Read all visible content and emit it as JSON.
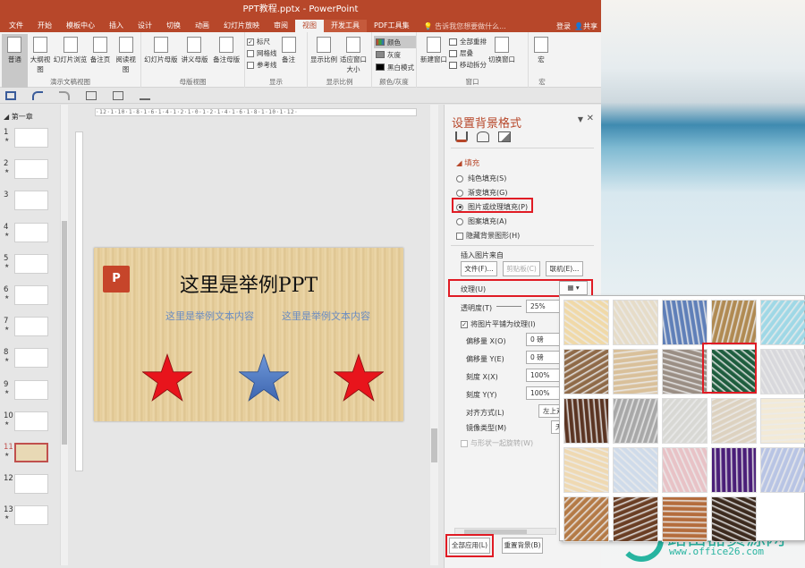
{
  "window": {
    "title": "PPT教程.pptx - PowerPoint"
  },
  "tabs": [
    "文件",
    "开始",
    "模板中心",
    "插入",
    "设计",
    "切换",
    "动画",
    "幻灯片放映",
    "审阅",
    "视图",
    "开发工具",
    "PDF工具集"
  ],
  "active_tab": "视图",
  "tell_me": "告诉我您想要做什么...",
  "account": {
    "login": "登录",
    "share": "共享"
  },
  "ribbon": {
    "presentation_views": {
      "label": "演示文稿视图",
      "items": [
        "普通",
        "大纲视图",
        "幻灯片浏览",
        "备注页",
        "阅读视图"
      ]
    },
    "master_views": {
      "label": "母版视图",
      "items": [
        "幻灯片母版",
        "讲义母版",
        "备注母版"
      ]
    },
    "show": {
      "label": "显示",
      "checks": [
        {
          "text": "标尺",
          "checked": true
        },
        {
          "text": "网格线",
          "checked": false
        },
        {
          "text": "参考线",
          "checked": false
        }
      ]
    },
    "notes": "备注",
    "zoom": {
      "label": "显示比例",
      "items": [
        "显示比例",
        "适应窗口大小"
      ]
    },
    "color": {
      "label": "颜色/灰度",
      "items": [
        "颜色",
        "灰度",
        "黑白模式"
      ]
    },
    "window": {
      "label": "窗口",
      "new_window": "新建窗口",
      "arrange_all": "全部重排",
      "cascade": "层叠",
      "move_split": "移动拆分",
      "switch_windows": "切换窗口"
    },
    "macro": {
      "label": "宏",
      "item": "宏"
    }
  },
  "sidebar": {
    "section": "第一章",
    "slides": [
      {
        "num": "1",
        "star": true
      },
      {
        "num": "2",
        "star": true
      },
      {
        "num": "3",
        "star": false
      },
      {
        "num": "4",
        "star": true
      },
      {
        "num": "5",
        "star": true
      },
      {
        "num": "6",
        "star": true
      },
      {
        "num": "7",
        "star": true
      },
      {
        "num": "8",
        "star": true
      },
      {
        "num": "9",
        "star": true
      },
      {
        "num": "10",
        "star": true
      },
      {
        "num": "11",
        "star": true,
        "selected": true
      },
      {
        "num": "12",
        "star": false
      },
      {
        "num": "13",
        "star": true
      }
    ]
  },
  "ruler": "·12·1·10·1·8·1·6·1·4·1·2·1·0·1·2·1·4·1·6·1·8·1·10·1·12·",
  "slide": {
    "logo": "P",
    "title": "这里是举例PPT",
    "subtitle_left": "这里是举例文本内容",
    "subtitle_right": "这里是举例文本内容",
    "star_colors": [
      "#e8141c",
      "#4472c4",
      "#e8141c"
    ]
  },
  "pane": {
    "title": "设置背景格式",
    "fill_header": "填充",
    "fill_options": [
      {
        "text": "纯色填充(S)",
        "checked": false
      },
      {
        "text": "渐变填充(G)",
        "checked": false
      },
      {
        "text": "图片或纹理填充(P)",
        "checked": true
      },
      {
        "text": "图案填充(A)",
        "checked": false
      }
    ],
    "hide_bg": "隐藏背景图形(H)",
    "insert_from": "插入图片来自",
    "buttons": {
      "file": "文件(F)...",
      "clipboard": "剪贴板(C)",
      "online": "联机(E)..."
    },
    "texture_label": "纹理(U)",
    "transparency_label": "透明度(T)",
    "transparency_value": "25%",
    "tile_check": "将图片平铺为纹理(I)",
    "offset_x_label": "偏移量 X(O)",
    "offset_x_value": "0 磅",
    "offset_y_label": "偏移量 Y(E)",
    "offset_y_value": "0 磅",
    "scale_x_label": "刻度 X(X)",
    "scale_x_value": "100%",
    "scale_y_label": "刻度 Y(Y)",
    "scale_y_value": "100%",
    "align_label": "对齐方式(L)",
    "align_value": "左上对",
    "mirror_label": "镜像类型(M)",
    "mirror_value": "无",
    "rotate_with_shape": "与形状一起旋转(W)",
    "apply_all": "全部应用(L)",
    "reset_bg": "重置背景(B)"
  },
  "textures": [
    "#f0d9a8",
    "#e6dcc8",
    "#5f7fb8",
    "#b08a52",
    "#9fd8e6",
    "#8f6a48",
    "#d9c09a",
    "#9a8e84",
    "#1e5d3e",
    "#d8d8dc",
    "#5a3422",
    "#a8a8a8",
    "#d8d8d4",
    "#ddd2c0",
    "#f3ead6",
    "#efd9b2",
    "#cfdbea",
    "#e8c2c6",
    "#4a1e78",
    "#b8c4e4",
    "#b47a46",
    "#6a3e24",
    "#b46c3c",
    "#3c2a1e",
    "#ffffff"
  ],
  "watermark": {
    "text": "路由器资源网",
    "url": "www.office26.com"
  }
}
